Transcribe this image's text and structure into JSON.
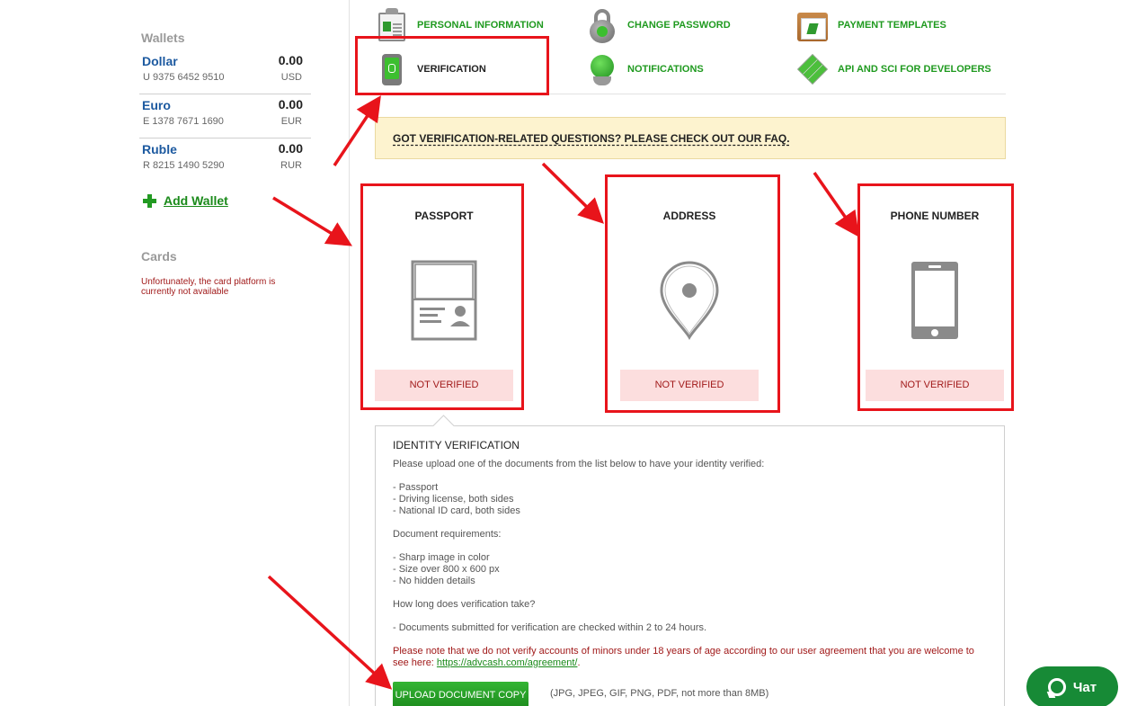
{
  "sidebar": {
    "wallets_heading": "Wallets",
    "wallets": [
      {
        "name": "Dollar",
        "number": "U 9375 6452 9510",
        "balance": "0.00",
        "currency": "USD"
      },
      {
        "name": "Euro",
        "number": "E 1378 7671 1690",
        "balance": "0.00",
        "currency": "EUR"
      },
      {
        "name": "Ruble",
        "number": "R 8215 1490 5290",
        "balance": "0.00",
        "currency": "RUR"
      }
    ],
    "add_wallet_label": "Add Wallet",
    "cards_heading": "Cards",
    "cards_message": "Unfortunately, the card platform is currently not available"
  },
  "nav": {
    "items": [
      {
        "label": "PERSONAL INFORMATION",
        "icon": "id-card-icon"
      },
      {
        "label": "CHANGE PASSWORD",
        "icon": "padlock-icon"
      },
      {
        "label": "PAYMENT TEMPLATES",
        "icon": "template-icon"
      },
      {
        "label": "VERIFICATION",
        "icon": "phone-fingerprint-icon",
        "active": true
      },
      {
        "label": "NOTIFICATIONS",
        "icon": "bell-icon"
      },
      {
        "label": "API AND SCI FOR DEVELOPERS",
        "icon": "cube-icon"
      }
    ]
  },
  "faq_banner": "GOT VERIFICATION-RELATED QUESTIONS? PLEASE CHECK OUT OUR FAQ.",
  "verification_cards": [
    {
      "title": "PASSPORT",
      "status": "NOT VERIFIED",
      "icon": "passport-icon"
    },
    {
      "title": "ADDRESS",
      "status": "NOT VERIFIED",
      "icon": "map-pin-icon"
    },
    {
      "title": "PHONE NUMBER",
      "status": "NOT VERIFIED",
      "icon": "smartphone-icon"
    }
  ],
  "identity": {
    "title": "IDENTITY VERIFICATION",
    "intro": "Please upload one of the documents from the list below to have your identity verified:",
    "documents": [
      "- Passport",
      "- Driving license, both sides",
      "- National ID card, both sides"
    ],
    "requirements_heading": "Document requirements:",
    "requirements": [
      "- Sharp image in color",
      "- Size over 800 x 600 px",
      "- No hidden details"
    ],
    "duration_heading": "How long does verification take?",
    "duration_text": "- Documents submitted for verification are checked within 2 to 24 hours.",
    "minors_notice": "Please note that we do not verify accounts of minors under 18 years of age according to our user agreement that you are welcome to see here: ",
    "agreement_link": "https://advcash.com/agreement/",
    "upload_button": "UPLOAD DOCUMENT COPY",
    "upload_note": "(JPG, JPEG, GIF, PNG, PDF, not more than 8MB)"
  },
  "chat": {
    "label": "Чат"
  },
  "colors": {
    "accent_green": "#1f9a1f",
    "link_blue": "#1d5aa0",
    "warning_red": "#a11a1a",
    "status_bg": "#fcdede",
    "faq_bg": "#fdf3cf",
    "annotation_red": "#e8141b"
  }
}
